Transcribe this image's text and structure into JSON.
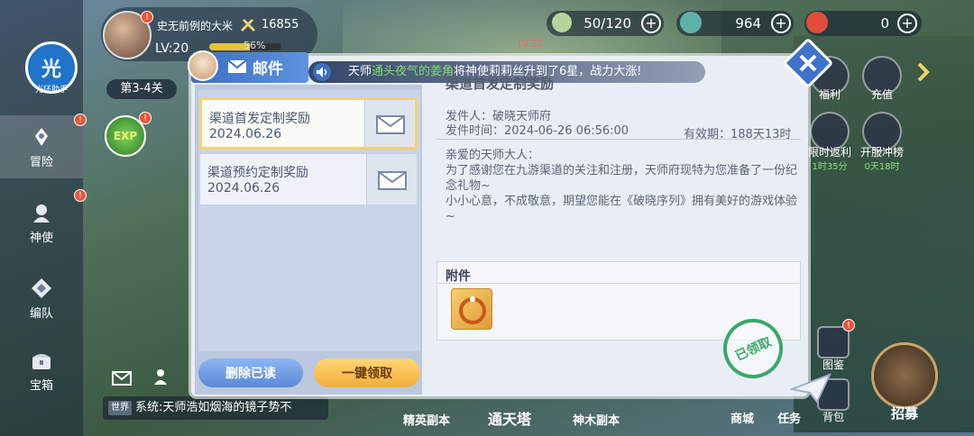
{
  "player": {
    "name": "史无前例的大米",
    "power": "16855",
    "level": "LV:20",
    "xp_percent": 56,
    "xp_label": "56%"
  },
  "resources": {
    "stamina": "50/120",
    "gems": "964",
    "tokens": "0"
  },
  "logo": {
    "char": "光",
    "sub": "光环助手"
  },
  "left_nav": {
    "items": [
      {
        "label": "冒险"
      },
      {
        "label": "神使"
      },
      {
        "label": "编队"
      },
      {
        "label": "宝箱"
      }
    ]
  },
  "stage": {
    "label": "第3-4关",
    "exp_label": "EXP"
  },
  "mail": {
    "title": "邮件",
    "list": [
      {
        "title": "渠道首发定制奖励",
        "date": "2024.06.26"
      },
      {
        "title": "渠道预约定制奖励",
        "date": "2024.06.26"
      }
    ],
    "detail": {
      "title": "渠道首发定制奖励",
      "sender": "发件人：破晓天师府",
      "time": "发件时间：2024-06-26 06:56:00",
      "expire": "有效期：188天13时",
      "greeting": "亲爱的天师大人：",
      "body1": "为了感谢您在九游渠道的关注和注册，天师府现特为您准备了一份纪念礼物~",
      "body2": "小小心意，不成敬意，期望您能在《破晓序列》拥有美好的游戏体验~"
    },
    "attachment_label": "附件",
    "stamp": "已领取",
    "delete_read": "删除已读",
    "claim_all": "一键领取"
  },
  "broadcast": {
    "pre": "天师",
    "highlight": "通头夜气的姜角",
    "post": "将神使莉莉丝升到了6星，战力大涨!"
  },
  "right_icons": [
    {
      "label": "福利"
    },
    {
      "label": "充值"
    },
    {
      "label": "限时返利",
      "sub": "1时35分"
    },
    {
      "label": "开服冲榜",
      "sub": "0天18时"
    }
  ],
  "right_bottom": {
    "gallery": "图鉴",
    "shop": "商城",
    "tasks": "任务",
    "bag": "背包",
    "recruit": "招募"
  },
  "bottom": {
    "world_tag": "世界",
    "chat": "系统:天师浩如烟海的镜子势不",
    "elite": "精英副本",
    "tower": "通天塔",
    "divine": "神木副本"
  },
  "map_level": "LV.21",
  "colors": {
    "mail_header": "#3a6fc2",
    "claim_button": "#f2ae3a",
    "delete_button": "#5a89d8",
    "stamp": "#3aa86a",
    "broadcast_highlight": "#7fe06a",
    "badge": "#e8553a"
  }
}
